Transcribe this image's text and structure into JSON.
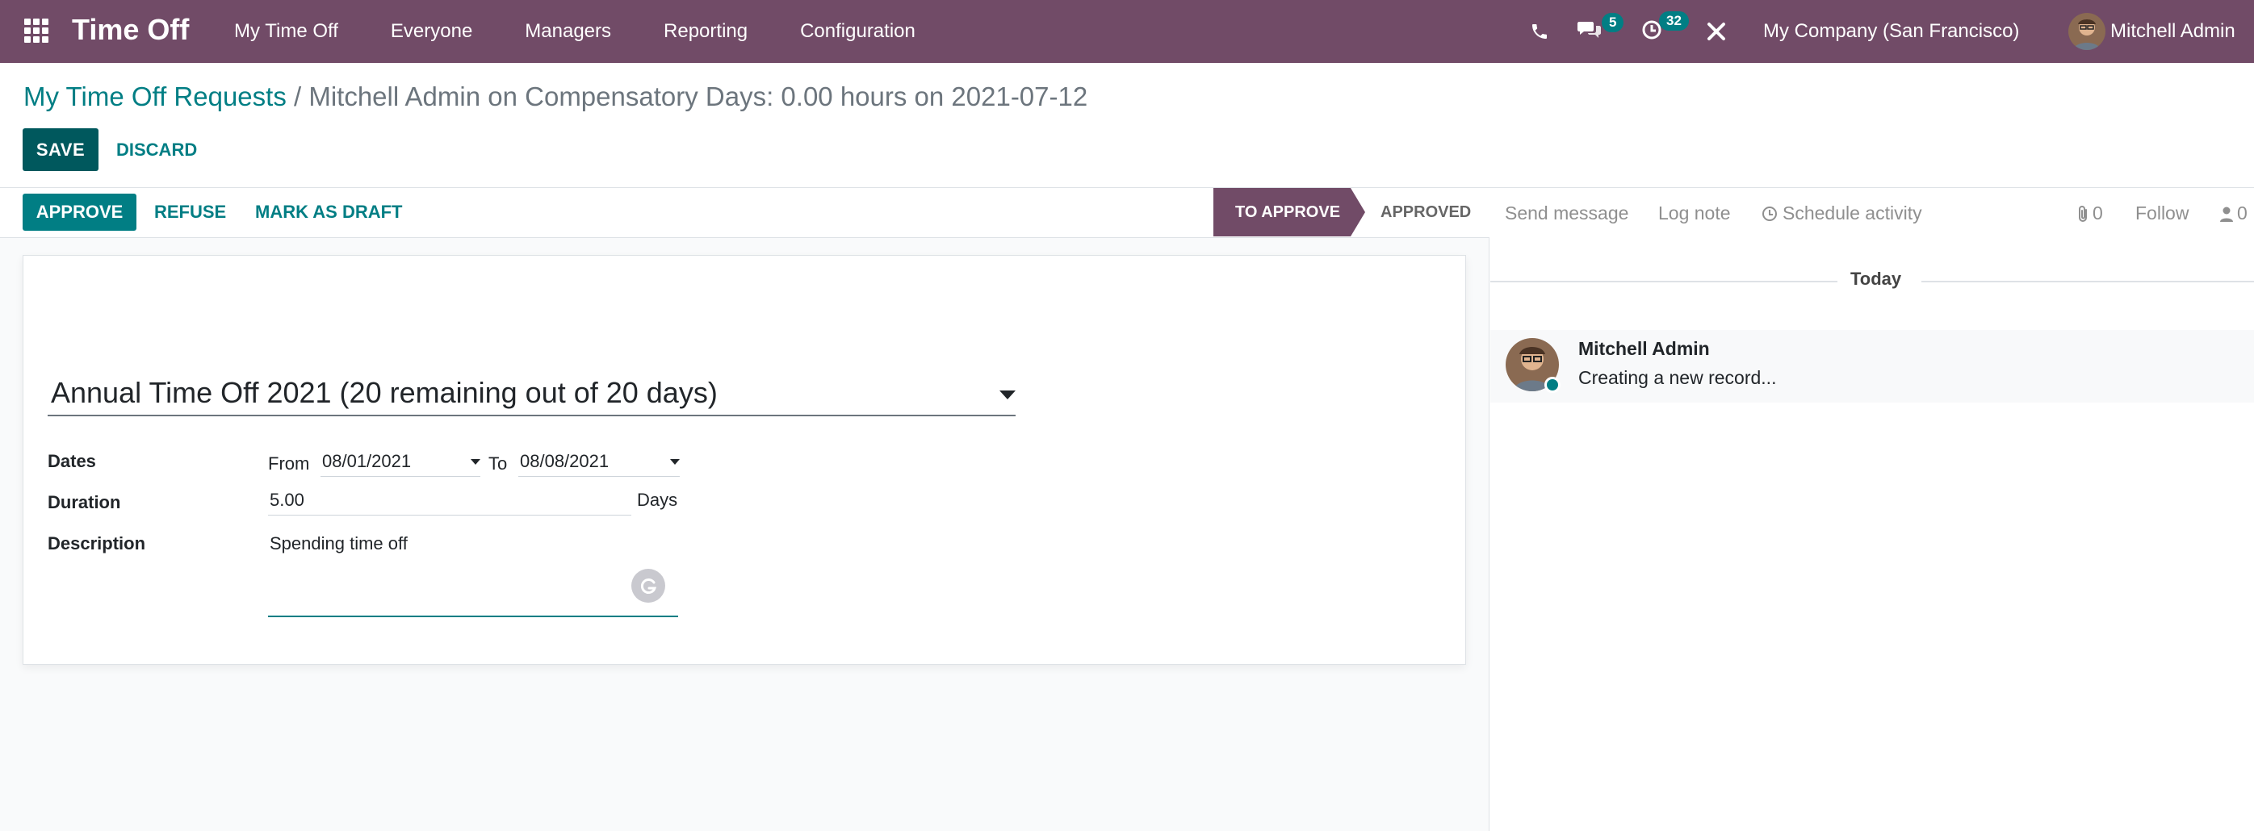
{
  "colors": {
    "brand": "#714B67",
    "accent": "#017E84",
    "save": "#00585D"
  },
  "navbar": {
    "apps_icon": "grid-icon",
    "app_name": "Time Off",
    "menu": [
      "My Time Off",
      "Everyone",
      "Managers",
      "Reporting",
      "Configuration"
    ],
    "phone_icon": "phone-icon",
    "messages_icon": "chat-bubbles-icon",
    "messages_count": "5",
    "activities_icon": "clock-icon",
    "activities_count": "32",
    "debug_icon": "tools-icon",
    "company": "My Company (San Francisco)",
    "user": "Mitchell Admin"
  },
  "breadcrumb": {
    "parent": "My Time Off Requests",
    "separator": "/",
    "current": "Mitchell Admin on Compensatory Days: 0.00 hours on 2021-07-12"
  },
  "actions": {
    "save": "SAVE",
    "discard": "DISCARD"
  },
  "statusbar": {
    "approve": "APPROVE",
    "refuse": "REFUSE",
    "mark_draft": "MARK AS DRAFT",
    "stage_current": "TO APPROVE",
    "stage_next": "APPROVED"
  },
  "form": {
    "leave_type": "Annual Time Off 2021 (20 remaining out of 20 days)",
    "dates_label": "Dates",
    "from_label": "From",
    "date_from": "08/01/2021",
    "to_label": "To",
    "date_to": "08/08/2021",
    "duration_label": "Duration",
    "duration": "5.00",
    "duration_unit": "Days",
    "description_label": "Description",
    "description": "Spending time off"
  },
  "chatter": {
    "send_message": "Send message",
    "log_note": "Log note",
    "schedule_activity": "Schedule activity",
    "attachments_count": "0",
    "follow": "Follow",
    "followers_count": "0",
    "today": "Today",
    "message_author": "Mitchell Admin",
    "message_body": "Creating a new record..."
  }
}
